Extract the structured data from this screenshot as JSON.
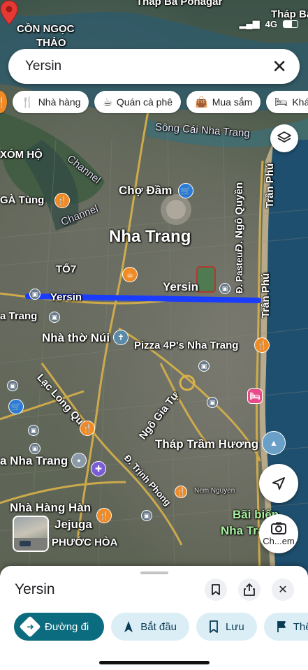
{
  "status_bar": {
    "network": "4G",
    "battery": "C"
  },
  "search": {
    "query": "Yersin"
  },
  "chips": [
    {
      "icon": "fork-knife-icon",
      "label": "Nhà hàng"
    },
    {
      "icon": "coffee-icon",
      "label": "Quán cà phê"
    },
    {
      "icon": "shopping-bag-icon",
      "label": "Mua sắm"
    },
    {
      "icon": "bed-icon",
      "label": "Khách"
    }
  ],
  "map": {
    "labels": {
      "thap_ba_ponagar": "Tháp Bà Ponagar",
      "thap_ba": "Tháp Bà",
      "con_ngoc_thao_1": "CỒN NGỌC",
      "con_ngoc_thao_2": "THẢO",
      "song_cai": "Sông Cái Nha Trang",
      "xom_ho": "XÓM HỘ",
      "channel_1": "Channel",
      "channel_2": "Channel",
      "cho_dam": "Chợ Đầm",
      "ga_tung": "GÀ Tùng",
      "nha_trang": "Nha Trang",
      "to_7": "TỔ7",
      "yersin_left": "Yersin",
      "yersin_pin": "Yersin",
      "ngo_quyen": "Đ. Ngô Quyền",
      "pasteur": "Đ. Pasteur",
      "tran_phu_top": "Trần Phú",
      "tran_phu_mid": "Trần Phú",
      "trang_left": "a Trang",
      "nha_tho_nui": "Nhà thờ Núi",
      "pizza": "Pizza 4P's Nha Trang",
      "lac_long_quan": "Lạc Long Quân",
      "ngo_gia_tu": "Ngô Gia Tự",
      "thap_tram_huong": "Tháp Trầm Hương",
      "a_nha_trang": "a Nha Trang",
      "trinh_phong": "Đ. Trịnh Phong",
      "nem_nguyen": "Nem Nguyen",
      "nha_hang_han_1": "Nhà Hàng Hàn",
      "nha_hang_han_2": "Jejuga",
      "phuoc_hoa": "PHƯỚC HÒA",
      "bai_bien_1": "Bãi biển",
      "bai_bien_2": "Nha Tra"
    }
  },
  "controls": {
    "lens_label": "Ch...em"
  },
  "sheet": {
    "title": "Yersin",
    "actions": [
      {
        "icon": "directions-icon",
        "label": "Đường đi"
      },
      {
        "icon": "navigation-arrow-icon",
        "label": "Bắt đầu"
      },
      {
        "icon": "bookmark-icon",
        "label": "Lưu"
      },
      {
        "icon": "flag-icon",
        "label": "Thêm"
      }
    ]
  },
  "colors": {
    "route": "#1a3cff",
    "primary_button": "#0b6b7f",
    "pin": "#e53935"
  }
}
